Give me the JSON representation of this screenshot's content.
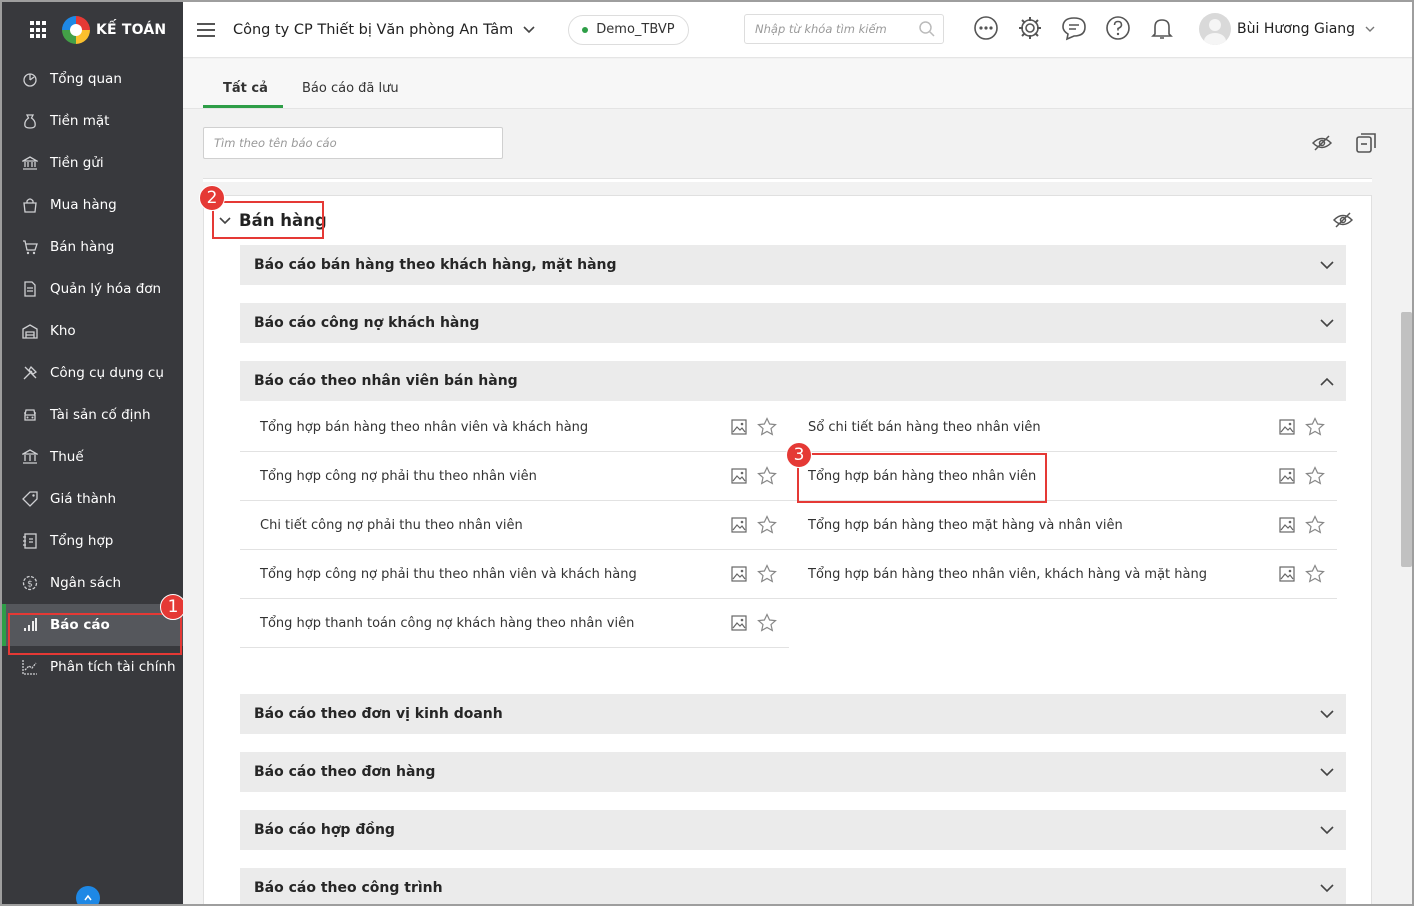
{
  "brand": {
    "name": "KẾ TOÁN"
  },
  "sidebar": {
    "items": [
      {
        "label": "Tổng quan",
        "icon": "dashboard-icon"
      },
      {
        "label": "Tiền mặt",
        "icon": "money-bag-icon"
      },
      {
        "label": "Tiền gửi",
        "icon": "bank-icon"
      },
      {
        "label": "Mua hàng",
        "icon": "shopping-bag-icon"
      },
      {
        "label": "Bán hàng",
        "icon": "cart-icon"
      },
      {
        "label": "Quản lý hóa đơn",
        "icon": "invoice-icon"
      },
      {
        "label": "Kho",
        "icon": "warehouse-icon"
      },
      {
        "label": "Công cụ dụng cụ",
        "icon": "tools-icon"
      },
      {
        "label": "Tài sản cố định",
        "icon": "vehicle-icon"
      },
      {
        "label": "Thuế",
        "icon": "tax-icon"
      },
      {
        "label": "Giá thành",
        "icon": "price-tag-icon"
      },
      {
        "label": "Tổng hợp",
        "icon": "ledger-icon"
      },
      {
        "label": "Ngân sách",
        "icon": "budget-icon"
      },
      {
        "label": "Báo cáo",
        "icon": "bar-chart-icon",
        "active": true
      },
      {
        "label": "Phân tích tài chính",
        "icon": "line-chart-icon"
      }
    ]
  },
  "header": {
    "company": "Công ty CP Thiết bị Văn phòng An Tâm",
    "database": "Demo_TBVP",
    "search_placeholder": "Nhập từ khóa tìm kiếm",
    "user_name": "Bùi Hương Giang"
  },
  "tabs": [
    {
      "label": "Tất cả",
      "active": true
    },
    {
      "label": "Báo cáo đã lưu",
      "active": false
    }
  ],
  "filter": {
    "placeholder": "Tìm theo tên báo cáo"
  },
  "group": {
    "title": "Bán hàng"
  },
  "sections": [
    {
      "title": "Báo cáo bán hàng theo khách hàng, mặt hàng",
      "expanded": false
    },
    {
      "title": "Báo cáo công nợ khách hàng",
      "expanded": false
    },
    {
      "title": "Báo cáo theo nhân viên bán hàng",
      "expanded": true
    },
    {
      "title": "Báo cáo theo đơn vị kinh doanh",
      "expanded": false
    },
    {
      "title": "Báo cáo theo đơn hàng",
      "expanded": false
    },
    {
      "title": "Báo cáo hợp đồng",
      "expanded": false
    },
    {
      "title": "Báo cáo theo công trình",
      "expanded": false
    }
  ],
  "reports_left": [
    "Tổng hợp bán hàng theo nhân viên và khách hàng",
    "Tổng hợp công nợ phải thu theo nhân viên",
    "Chi tiết công nợ phải thu theo nhân viên",
    "Tổng hợp công nợ phải thu theo nhân viên và khách hàng",
    "Tổng hợp thanh toán công nợ khách hàng theo nhân viên"
  ],
  "reports_right": [
    "Sổ chi tiết bán hàng theo nhân viên",
    "Tổng hợp bán hàng theo nhân viên",
    "Tổng hợp bán hàng theo mặt hàng và nhân viên",
    "Tổng hợp bán hàng theo nhân viên, khách hàng và mặt hàng"
  ],
  "callouts": [
    "1",
    "2",
    "3"
  ],
  "colors": {
    "sidebar_bg": "#38393d",
    "accent_green": "#2e9e47",
    "callout_red": "#e53935"
  }
}
